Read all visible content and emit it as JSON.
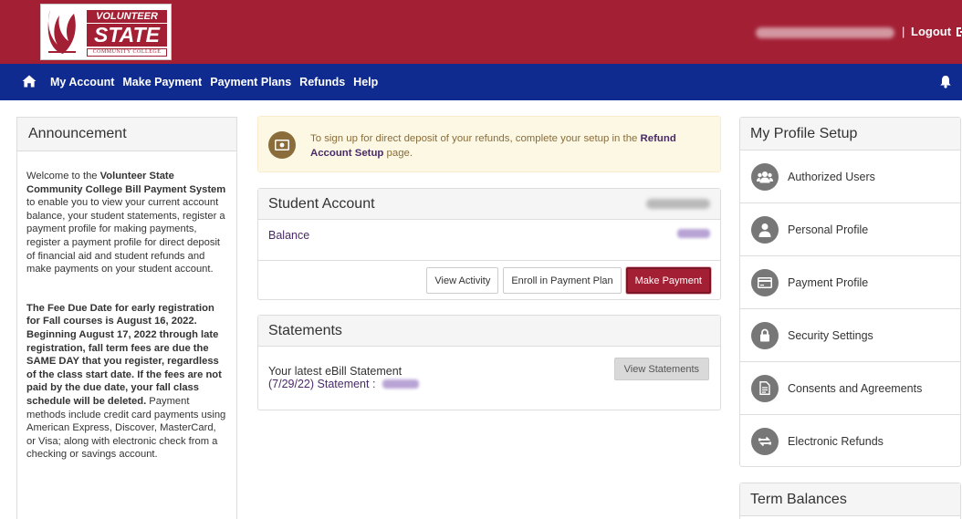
{
  "header": {
    "logo": {
      "line1": "VOLUNTEER",
      "line2": "STATE",
      "line3": "COMMUNITY COLLEGE"
    },
    "separator": "|",
    "logout_label": "Logout"
  },
  "nav": {
    "home_icon": "home-icon",
    "items": [
      "My Account",
      "Make Payment",
      "Payment Plans",
      "Refunds",
      "Help"
    ],
    "bell_icon": "bell-icon"
  },
  "announcement": {
    "title": "Announcement",
    "p1_a": "Welcome to the ",
    "p1_b": "Volunteer State Community College Bill Payment System",
    "p1_c": " to enable you to view your current account balance, your student statements, register a payment profile for making payments, register a payment profile for direct deposit of financial aid and student refunds and make payments on your student account.",
    "p2_a": "The Fee Due Date for early registration for Fall courses is August 16, 2022. Beginning August 17, 2022 through late registration, fall term fees are due the SAME DAY that you register, regardless of the class start date. If the fees are not paid by the due date, your fall class schedule will be deleted.",
    "p2_b": " Payment methods include credit card payments using American Express, Discover, MasterCard, or Visa; along with electronic check from a checking or savings account."
  },
  "alert": {
    "text_a": "To sign up for direct deposit of your refunds, complete your setup in the ",
    "link": "Refund Account Setup",
    "text_b": " page."
  },
  "student_account": {
    "title": "Student Account",
    "balance_label": "Balance",
    "buttons": {
      "view_activity": "View Activity",
      "enroll": "Enroll in Payment Plan",
      "make_payment": "Make Payment"
    }
  },
  "statements": {
    "title": "Statements",
    "latest": "Your latest eBill Statement",
    "statement_link": "(7/29/22) Statement :",
    "view_button": "View Statements"
  },
  "profile_setup": {
    "title": "My Profile Setup",
    "items": [
      {
        "label": "Authorized Users",
        "icon": "users-icon"
      },
      {
        "label": "Personal Profile",
        "icon": "person-icon"
      },
      {
        "label": "Payment Profile",
        "icon": "credit-card-icon"
      },
      {
        "label": "Security Settings",
        "icon": "lock-icon"
      },
      {
        "label": "Consents and Agreements",
        "icon": "document-icon"
      },
      {
        "label": "Electronic Refunds",
        "icon": "refund-icon"
      }
    ]
  },
  "term_balances": {
    "title": "Term Balances"
  }
}
